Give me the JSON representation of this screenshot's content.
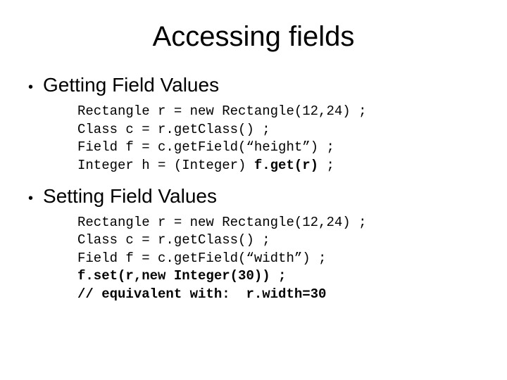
{
  "title": "Accessing fields",
  "sections": {
    "getting": {
      "heading": "Getting Field Values",
      "code": {
        "l1": "Rectangle r = new Rectangle(12,24) ;",
        "l2": "Class c = r.getClass() ;",
        "l3": "Field f = c.getField(“height”) ;",
        "l4a": "Integer h = (Integer) ",
        "l4b": "f.get(r)",
        "l4c": " ;"
      }
    },
    "setting": {
      "heading": "Setting Field Values",
      "code": {
        "l1": "Rectangle r = new Rectangle(12,24) ;",
        "l2": "Class c = r.getClass() ;",
        "l3": "Field f = c.getField(“width”) ;",
        "l4": "f.set(r,new Integer(30)) ;",
        "l5": "// equivalent with:  r.width=30"
      }
    }
  }
}
